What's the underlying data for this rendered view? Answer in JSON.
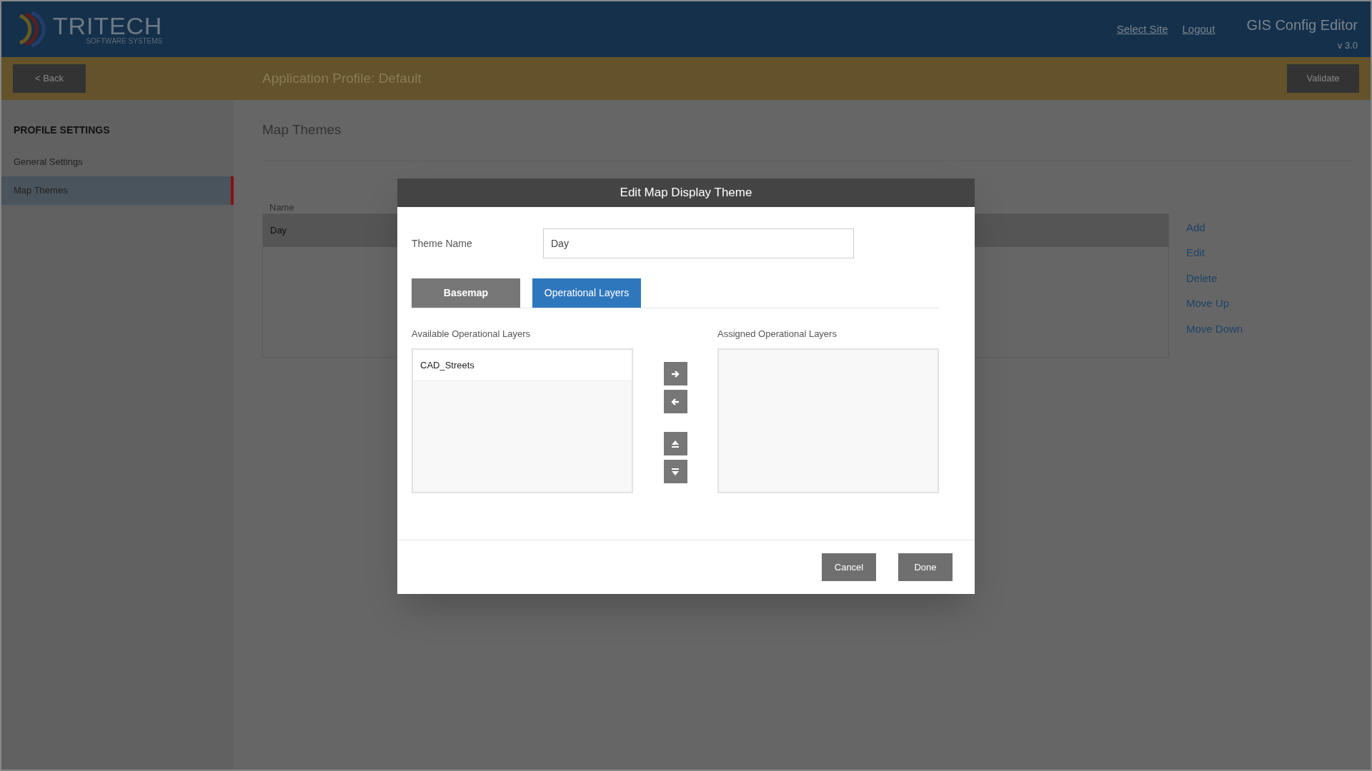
{
  "header": {
    "logo_text": "TRITECH",
    "logo_subtext": "SOFTWARE SYSTEMS",
    "links": [
      "Select Site",
      "Logout"
    ],
    "app_title": "GIS Config Editor",
    "version": "v 3.0"
  },
  "toolbar": {
    "back_button": "< Back",
    "title": "Application Profile: Default",
    "validate_button": "Validate"
  },
  "sidebar": {
    "heading": "PROFILE SETTINGS",
    "items": [
      {
        "label": "General Settings",
        "selected": false
      },
      {
        "label": "Map Themes",
        "selected": true
      }
    ]
  },
  "content": {
    "title": "Map Themes",
    "table": {
      "columns": [
        "Name"
      ],
      "rows": [
        {
          "name": "Day",
          "selected": true
        }
      ]
    },
    "actions": [
      "Add",
      "Edit",
      "Delete",
      "Move Up",
      "Move Down"
    ]
  },
  "dialog": {
    "title": "Edit Map Display Theme",
    "theme_name_label": "Theme Name",
    "theme_name_value": "Day",
    "tabs": [
      {
        "label": "Basemap",
        "selected": false
      },
      {
        "label": "Operational Layers",
        "selected": true
      }
    ],
    "available_label": "Available Operational Layers",
    "available_items": [
      "CAD_Streets"
    ],
    "assigned_label": "Assigned Operational Layers",
    "buttons": [
      "Cancel",
      "Done"
    ]
  }
}
